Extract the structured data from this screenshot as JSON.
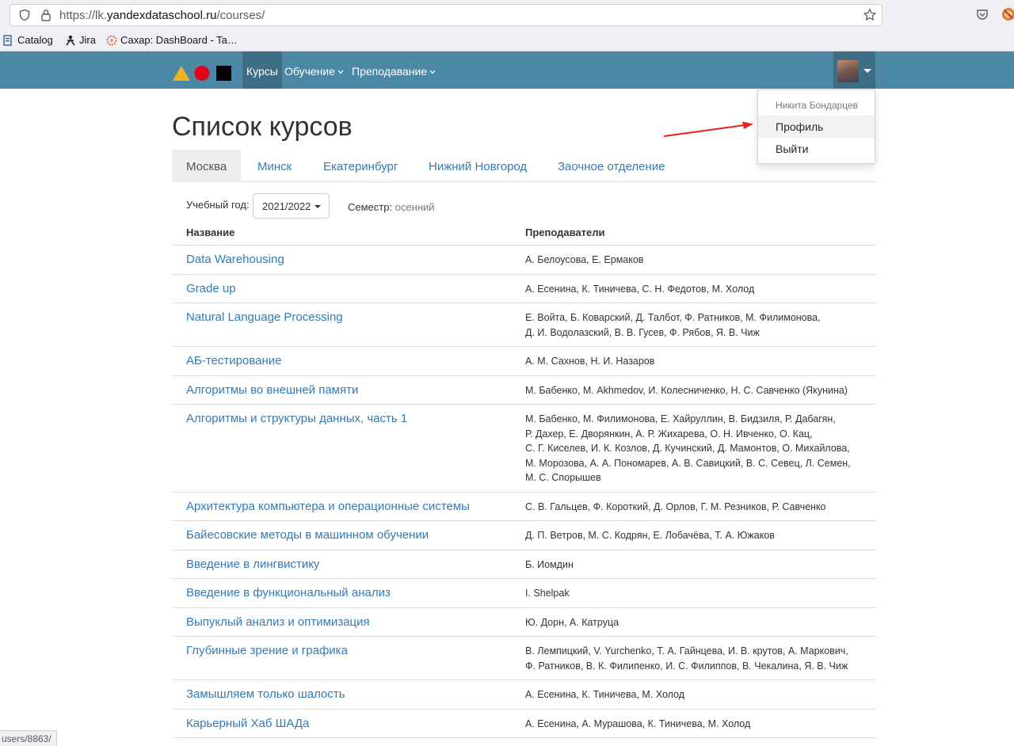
{
  "browser": {
    "url_prefix": "https://lk.",
    "url_host": "yandexdataschool.ru",
    "url_path": "/courses/",
    "bookmarks": [
      "Catalog",
      "Jira",
      "Сахар: DashBoard - Ta…"
    ]
  },
  "navbar": {
    "items": [
      "Курсы",
      "Обучение",
      "Преподавание"
    ],
    "colors": {
      "bar": "#4b88a5",
      "active": "#3d6e85"
    }
  },
  "user_menu": {
    "name": "Никита Бондарцев",
    "items": [
      "Профиль",
      "Выйти"
    ]
  },
  "page": {
    "title": "Список курсов",
    "tabs": [
      "Москва",
      "Минск",
      "Екатеринбург",
      "Нижний Новгород",
      "Заочное отделение"
    ],
    "filters": {
      "year_label": "Учебный год:",
      "year_value": "2021/2022",
      "semester_label": "Семестр:",
      "semester_value": "осенний"
    },
    "table": {
      "headers": [
        "Название",
        "Преподаватели"
      ],
      "rows": [
        {
          "name": "Data Warehousing",
          "teachers": [
            "А. Белоусова, Е. Ермаков"
          ]
        },
        {
          "name": "Grade up",
          "teachers": [
            "А. Есенина, К. Тиничева, С. Н. Федотов, М. Холод"
          ]
        },
        {
          "name": "Natural Language Processing",
          "teachers": [
            "Е. Войта, Б. Коварский, Д. Талбот, Ф. Ратников, М. Филимонова,",
            "Д. И. Водолазский, В. В. Гусев, Ф. Рябов, Я. В. Чиж"
          ]
        },
        {
          "name": "АБ-тестирование",
          "teachers": [
            "А. М. Сахнов, Н. И. Назаров"
          ]
        },
        {
          "name": "Алгоритмы во внешней памяти",
          "teachers": [
            "М. Бабенко, М. Akhmedov, И. Колесниченко, Н. С. Савченко (Якунина)"
          ]
        },
        {
          "name": "Алгоритмы и структуры данных, часть 1",
          "teachers": [
            "М. Бабенко, М. Филимонова, Е. Хайруллин, В. Бидзиля, Р. Дабагян,",
            "Р. Дахер, Е. Дворянкин, А. Р. Жихарева, О. Н. Ивченко, О. Кац,",
            "С. Г. Киселев, И. К. Козлов, Д. Кучинский, Д. Мамонтов, О. Михайлова,",
            "М. Морозова, А. А. Пономарев, А. В. Савицкий, В. С. Севец, Л. Семен,",
            "М. С. Спорышев"
          ]
        },
        {
          "name": "Архитектура компьютера и операционные системы",
          "teachers": [
            "С. В. Гальцев, Ф. Короткий, Д. Орлов, Г. М. Резников, Р. Савченко"
          ]
        },
        {
          "name": "Байесовские методы в машинном обучении",
          "teachers": [
            "Д. П. Ветров, М. С. Кодрян, Е. Лобачёва, Т. А. Южаков"
          ]
        },
        {
          "name": "Введение в лингвистику",
          "teachers": [
            "Б. Иомдин"
          ]
        },
        {
          "name": "Введение в функциональный анализ",
          "teachers": [
            "I. Shelpak"
          ]
        },
        {
          "name": "Выпуклый анализ и оптимизация",
          "teachers": [
            "Ю. Дорн, А. Катруца"
          ]
        },
        {
          "name": "Глубинные зрение и графика",
          "teachers": [
            "В. Лемпицкий, V. Yurchenko, Т. А. Гайнцева, И. В. крутов, А. Маркович,",
            "Ф. Ратников, В. К. Филипенко, И. С. Филиппов, В. Чекалина, Я. В. Чиж"
          ]
        },
        {
          "name": "Замышляем только шалость",
          "teachers": [
            "А. Есенина, К. Тиничева, М. Холод"
          ]
        },
        {
          "name": "Карьерный Хаб ШАДа",
          "teachers": [
            "А. Есенина, А. Мурашова, К. Тиничева, М. Холод"
          ]
        }
      ]
    }
  },
  "status_bar": {
    "text": "users/8863/"
  }
}
